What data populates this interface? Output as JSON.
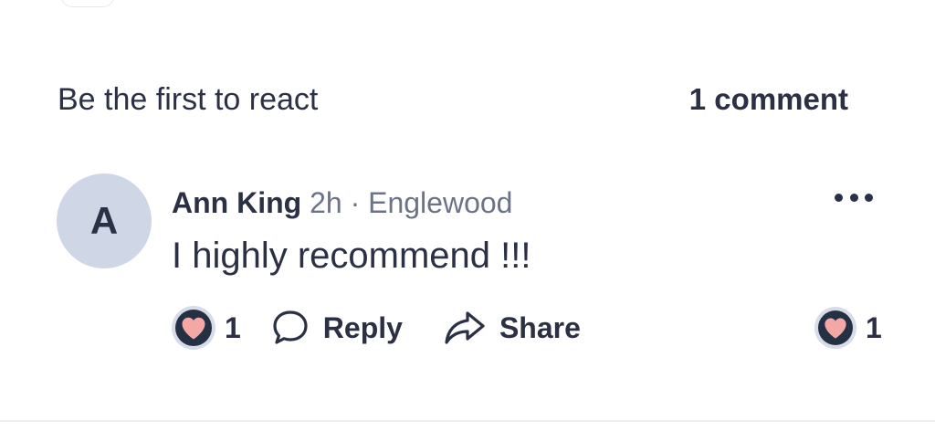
{
  "reactions": {
    "summary": "Be the first to react",
    "comments_count": "1 comment"
  },
  "comment": {
    "avatar_initial": "A",
    "author": "Ann King",
    "time": "2h",
    "separator": "·",
    "location": "Englewood",
    "text": "I highly recommend !!!",
    "more_icon": "more-horizontal-icon",
    "actions": {
      "react_icon": "heart-icon",
      "reaction_count": "1",
      "reply_icon": "speech-bubble-icon",
      "reply_label": "Reply",
      "share_icon": "share-arrow-icon",
      "share_label": "Share"
    },
    "reaction_summary": {
      "icon": "heart-icon",
      "count": "1"
    }
  },
  "colors": {
    "text": "#2b3044",
    "muted_text": "#6d7386",
    "avatar_bg": "#cfd6e6",
    "heart_fill": "#f3a8a6",
    "heart_badge_bg": "#243044"
  }
}
